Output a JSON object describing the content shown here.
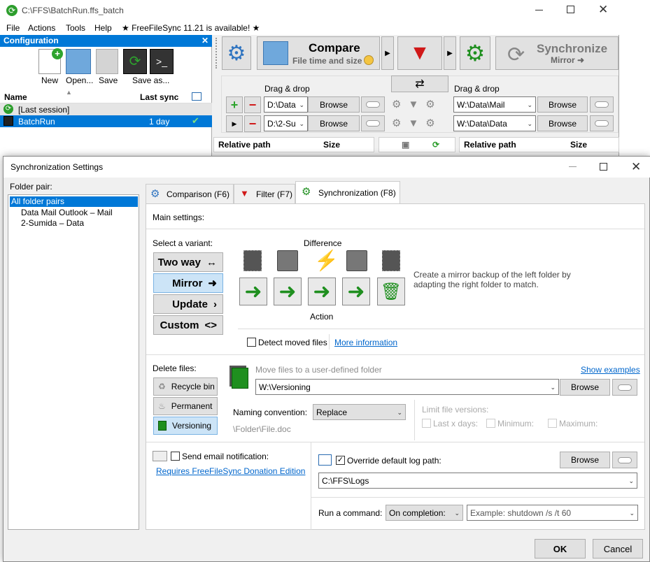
{
  "window": {
    "title": "C:\\FFS\\BatchRun.ffs_batch"
  },
  "menu": {
    "file": "File",
    "actions": "Actions",
    "tools": "Tools",
    "help": "Help",
    "update_notice": "★ FreeFileSync 11.21 is available! ★"
  },
  "config": {
    "title": "Configuration",
    "buttons": {
      "new": "New",
      "open": "Open...",
      "save": "Save",
      "save_as": "Save as..."
    },
    "columns": {
      "name": "Name",
      "last_sync": "Last sync"
    },
    "rows": [
      {
        "name": "[Last session]",
        "last_sync": ""
      },
      {
        "name": "BatchRun",
        "last_sync": "1 day"
      }
    ]
  },
  "toolbar": {
    "compare_title": "Compare",
    "compare_sub": "File time and size",
    "sync_title": "Synchronize",
    "sync_sub": "Mirror ➜"
  },
  "pairs": {
    "drag_drop": "Drag & drop",
    "browse": "Browse",
    "left": [
      {
        "path": "D:\\Data"
      },
      {
        "path": "D:\\2-Su"
      }
    ],
    "right": [
      {
        "path": "W:\\Data\\Mail"
      },
      {
        "path": "W:\\Data\\Data"
      }
    ]
  },
  "grid": {
    "relative_path": "Relative path",
    "size": "Size"
  },
  "dialog": {
    "title": "Synchronization Settings",
    "folder_pair_label": "Folder pair:",
    "folder_pairs": [
      "All folder pairs",
      "Data Mail Outlook – Mail",
      "2-Sumida – Data"
    ],
    "tabs": {
      "comparison": "Comparison (F6)",
      "filter": "Filter (F7)",
      "sync": "Synchronization (F8)"
    },
    "main_settings": "Main settings:",
    "select_variant": "Select a variant:",
    "variants": {
      "two_way": "Two way",
      "mirror": "Mirror",
      "update": "Update",
      "custom": "Custom"
    },
    "difference": "Difference",
    "action": "Action",
    "variant_desc": "Create a mirror backup of the left folder by adapting the right folder to match.",
    "detect_moved": "Detect moved files",
    "more_info": "More information",
    "delete_files": "Delete files:",
    "delete_opts": {
      "recycle": "Recycle bin",
      "permanent": "Permanent",
      "versioning": "Versioning"
    },
    "move_files_label": "Move files to a user-defined folder",
    "show_examples": "Show examples",
    "versioning_path": "W:\\Versioning",
    "naming_label": "Naming convention:",
    "naming_value": "Replace",
    "naming_example": "\\Folder\\File.doc",
    "limit_versions": "Limit file versions:",
    "last_x_days": "Last x days:",
    "minimum": "Minimum:",
    "maximum": "Maximum:",
    "email_label": "Send email notification:",
    "email_link": "Requires FreeFileSync Donation Edition",
    "override_log": "Override default log path:",
    "log_path": "C:\\FFS\\Logs",
    "run_command": "Run a command:",
    "on_completion": "On completion:",
    "command_placeholder": "Example: shutdown /s /t 60",
    "ok": "OK",
    "cancel": "Cancel"
  }
}
